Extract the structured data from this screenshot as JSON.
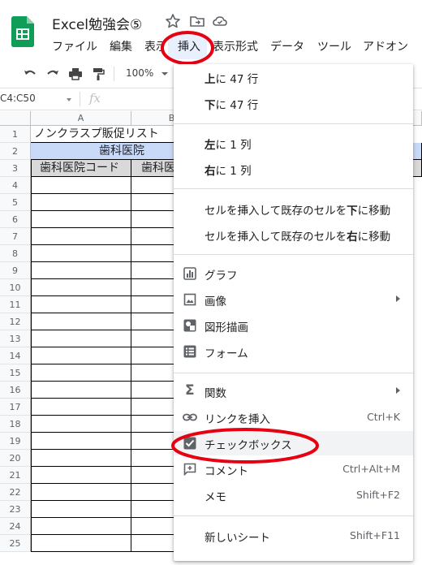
{
  "doc": {
    "title": "Excel勉強会⑤"
  },
  "menubar": {
    "items": [
      "ファイル",
      "編集",
      "表示",
      "挿入",
      "表示形式",
      "データ",
      "ツール",
      "アドオン"
    ],
    "active": "挿入"
  },
  "toolbar": {
    "zoom": "100%"
  },
  "formula_bar": {
    "name_box": "C4:C50",
    "fx": "fx"
  },
  "sheet": {
    "col_headers": [
      "A",
      "B"
    ],
    "row_numbers": [
      "1",
      "2",
      "3",
      "4",
      "5",
      "6",
      "7",
      "8",
      "9",
      "10",
      "11",
      "12",
      "13",
      "14",
      "15",
      "16",
      "17",
      "18",
      "19",
      "20",
      "21",
      "22",
      "23",
      "24",
      "25"
    ],
    "a1": "ノンクラスプ販促リスト",
    "row2_label": "歯科医院",
    "a3": "歯科医院コード",
    "b3": "歯科医"
  },
  "insert_menu": {
    "row_above": {
      "pre": "上",
      "post": "に 47 行"
    },
    "row_below": {
      "pre": "下",
      "post": "に 47 行"
    },
    "col_left": {
      "pre": "左",
      "post": "に 1 列"
    },
    "col_right": {
      "pre": "右",
      "post": "に 1 列"
    },
    "shift_down": {
      "pre": "セルを挿入して既存のセルを",
      "bold": "下",
      "post": "に移動"
    },
    "shift_right": {
      "pre": "セルを挿入して既存のセルを",
      "bold": "右",
      "post": "に移動"
    },
    "chart": "グラフ",
    "image": "画像",
    "drawing": "図形描画",
    "form": "フォーム",
    "function": "関数",
    "link": "リンクを挿入",
    "link_shortcut": "Ctrl+K",
    "checkbox": "チェックボックス",
    "comment": "コメント",
    "comment_shortcut": "Ctrl+Alt+M",
    "note": "メモ",
    "note_shortcut": "Shift+F2",
    "new_sheet": "新しいシート",
    "new_sheet_shortcut": "Shift+F11"
  },
  "colors": {
    "highlight_red": "#e60012",
    "sheets_green": "#0f9d58",
    "header_blue": "#c9daf8"
  }
}
